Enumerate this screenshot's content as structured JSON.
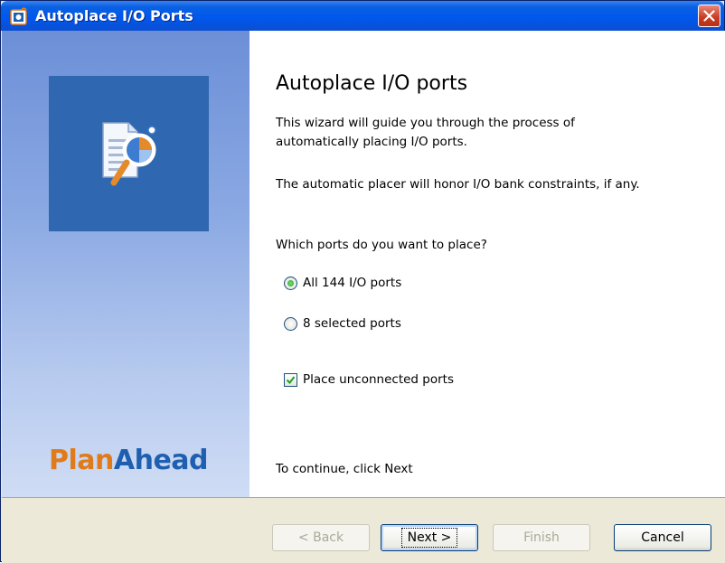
{
  "window": {
    "title": "Autoplace I/O Ports"
  },
  "banner": {
    "brand_part1": "Plan",
    "brand_part2": "Ahead"
  },
  "main": {
    "heading": "Autoplace I/O ports",
    "intro_line1": "This wizard will guide you through the process of",
    "intro_line2": "automatically placing I/O ports.",
    "constraints_note": "The automatic placer will honor I/O bank constraints, if any.",
    "question": "Which ports do you want to place?",
    "options": [
      {
        "label": "All 144 I/O ports",
        "selected": true
      },
      {
        "label": "8 selected ports",
        "selected": false
      }
    ],
    "checkbox": {
      "label": "Place unconnected ports",
      "checked": true
    },
    "continue_hint": "To continue, click Next"
  },
  "buttons": {
    "back": "< Back",
    "next": "Next >",
    "finish": "Finish",
    "cancel": "Cancel"
  },
  "colors": {
    "titlebar": "#0058ee",
    "brand_orange": "#e07b1a",
    "brand_blue": "#1f5fb0",
    "radio_selected": "#21a121",
    "check_mark": "#21a121"
  },
  "icons": [
    "app-icon",
    "close-icon",
    "wizard-document-magnifier-icon",
    "radio-icon",
    "checkmark-icon"
  ]
}
